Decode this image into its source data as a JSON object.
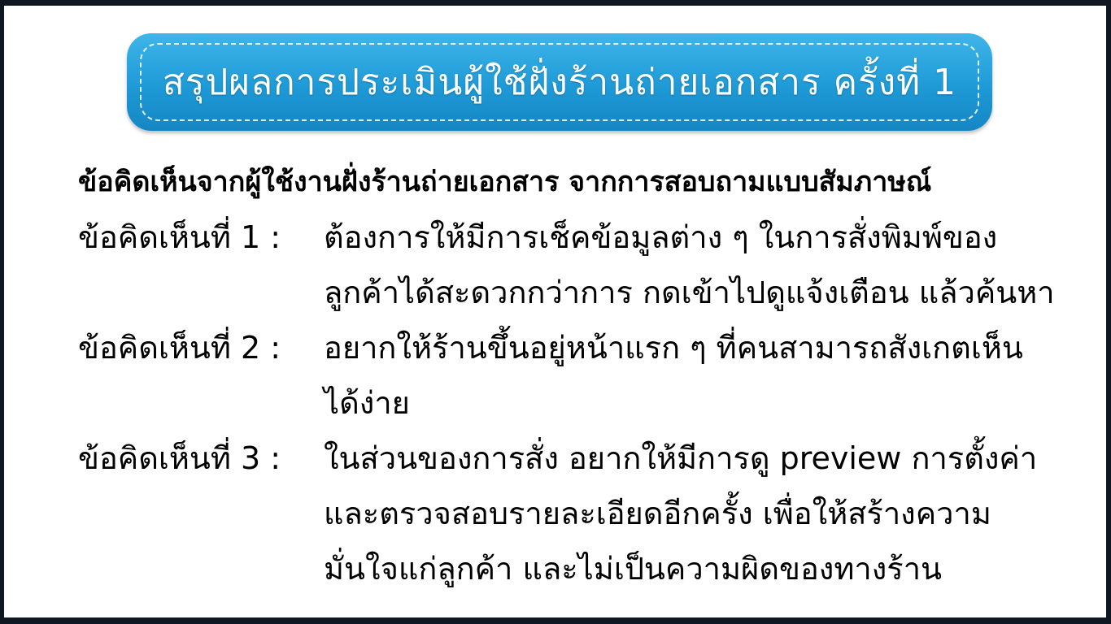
{
  "banner": {
    "title": "สรุปผลการประเมินผู้ใช้ฝั่งร้านถ่ายเอกสาร ครั้งที่ 1"
  },
  "heading": "ข้อคิดเห็นจากผู้ใช้งานฝั่งร้านถ่ายเอกสาร จากการสอบถามแบบสัมภาษณ์",
  "items": [
    {
      "label": "ข้อคิดเห็นที่ 1 :",
      "lines": [
        "ต้องการให้มีการเช็คข้อมูลต่าง ๆ ในการสั่งพิมพ์ของ",
        "ลูกค้าได้สะดวกกว่าการ กดเข้าไปดูแจ้งเตือน แล้วค้นหา"
      ]
    },
    {
      "label": "ข้อคิดเห็นที่ 2 :",
      "lines": [
        "อยากให้ร้านขึ้นอยู่หน้าแรก ๆ ที่คนสามารถสังเกตเห็น",
        "ได้ง่าย"
      ]
    },
    {
      "label": "ข้อคิดเห็นที่ 3 :",
      "lines": [
        "ในส่วนของการสั่ง อยากให้มีการดู preview การตั้งค่า",
        "และตรวจสอบรายละเอียดอีกครั้ง เพื่อให้สร้างความ",
        "มั่นใจแก่ลูกค้า และไม่เป็นความผิดของทางร้าน"
      ]
    }
  ]
}
